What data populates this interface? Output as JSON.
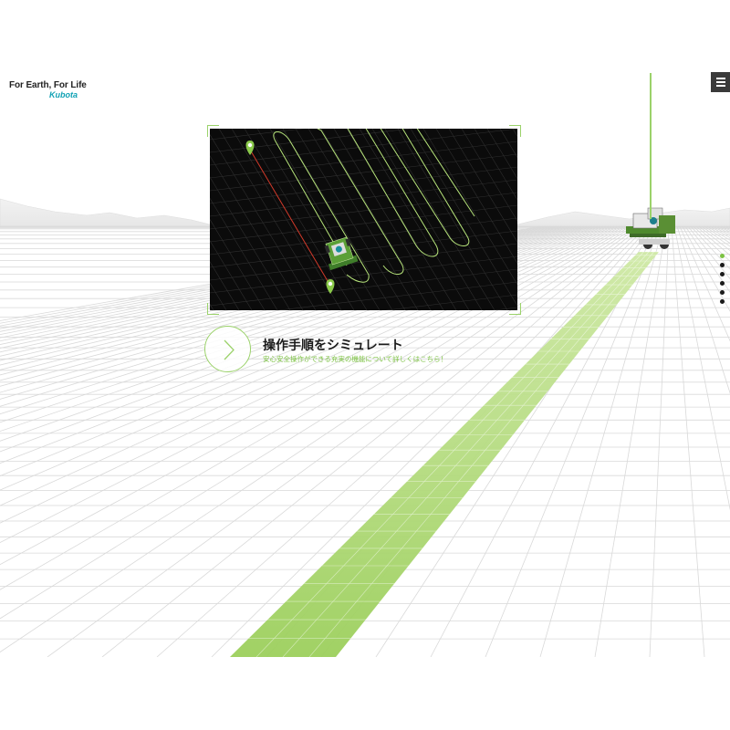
{
  "brand": {
    "tagline": "For Earth, For Life",
    "logo_text": "Kubota",
    "logo_color": "#0fa1b4"
  },
  "header": {
    "menu_icon": "hamburger-menu-icon"
  },
  "panel": {
    "type": "route-simulation-map",
    "background": "#0b0b0b",
    "grid_color": "#2f2f2f",
    "route_color": "#b6e37a",
    "ab_line_color": "#d23a2a",
    "start_marker_icon": "map-pin-icon",
    "end_marker_icon": "map-pin-icon",
    "vehicle_icon": "rice-transplanter-icon"
  },
  "cta": {
    "icon": "chevron-right-icon",
    "title": "操作手順をシミュレート",
    "subtitle": "安心安全操作ができる充実の機能について詳しくはこちら！"
  },
  "pager": {
    "count": 6,
    "active_index": 0,
    "active_color": "#7cc242",
    "inactive_color": "#1a1a1a"
  },
  "scene": {
    "field_path_color": "#a6d56b",
    "grid_color": "#d9d9d9",
    "vehicle_icon": "rice-transplanter-icon"
  }
}
